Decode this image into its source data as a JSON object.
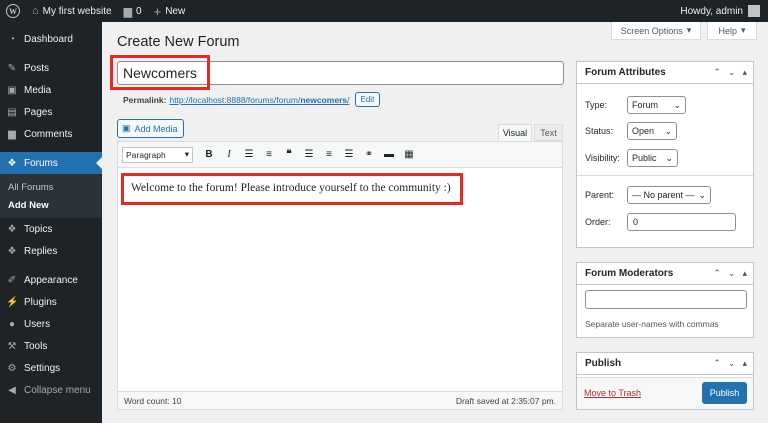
{
  "adminbar": {
    "site_name": "My first website",
    "comments_count": "0",
    "new_label": "New",
    "greeting": "Howdy, admin"
  },
  "sidebar": {
    "items": [
      {
        "label": "Dashboard",
        "icon": "dashboard-icon"
      },
      {
        "label": "Posts",
        "icon": "pin-icon"
      },
      {
        "label": "Media",
        "icon": "media-icon"
      },
      {
        "label": "Pages",
        "icon": "page-icon"
      },
      {
        "label": "Comments",
        "icon": "comment-icon"
      },
      {
        "label": "Forums",
        "icon": "forums-icon"
      },
      {
        "label": "Topics",
        "icon": "topics-icon"
      },
      {
        "label": "Replies",
        "icon": "replies-icon"
      },
      {
        "label": "Appearance",
        "icon": "brush-icon"
      },
      {
        "label": "Plugins",
        "icon": "plugin-icon"
      },
      {
        "label": "Users",
        "icon": "user-icon"
      },
      {
        "label": "Tools",
        "icon": "wrench-icon"
      },
      {
        "label": "Settings",
        "icon": "settings-icon"
      },
      {
        "label": "Collapse menu",
        "icon": "collapse-icon"
      }
    ],
    "submenu": [
      "All Forums",
      "Add New"
    ]
  },
  "screen_options": "Screen Options",
  "help": "Help",
  "page_title": "Create New Forum",
  "title_input": {
    "value": "Newcomers"
  },
  "permalink": {
    "label": "Permalink:",
    "url_base": "http://localhost:8888/forums/forum/",
    "slug": "newcomers",
    "trailing": "/",
    "edit_label": "Edit"
  },
  "editor": {
    "add_media": "Add Media",
    "tab_visual": "Visual",
    "tab_text": "Text",
    "format": "Paragraph",
    "content": "Welcome to the forum! Please introduce yourself to the community :)",
    "word_count": "Word count: 10",
    "draft_saved": "Draft saved at 2:35:07 pm."
  },
  "forum_attributes": {
    "title": "Forum Attributes",
    "type_label": "Type:",
    "type_value": "Forum",
    "status_label": "Status:",
    "status_value": "Open",
    "visibility_label": "Visibility:",
    "visibility_value": "Public",
    "parent_label": "Parent:",
    "parent_value": "— No parent —",
    "order_label": "Order:",
    "order_value": "0"
  },
  "forum_moderators": {
    "title": "Forum Moderators",
    "help": "Separate user-names with commas"
  },
  "publish": {
    "title": "Publish",
    "trash": "Move to Trash",
    "button": "Publish"
  },
  "colors": {
    "accent": "#2271b1",
    "adminbar": "#1d2327",
    "highlight_box": "#e22b25"
  }
}
